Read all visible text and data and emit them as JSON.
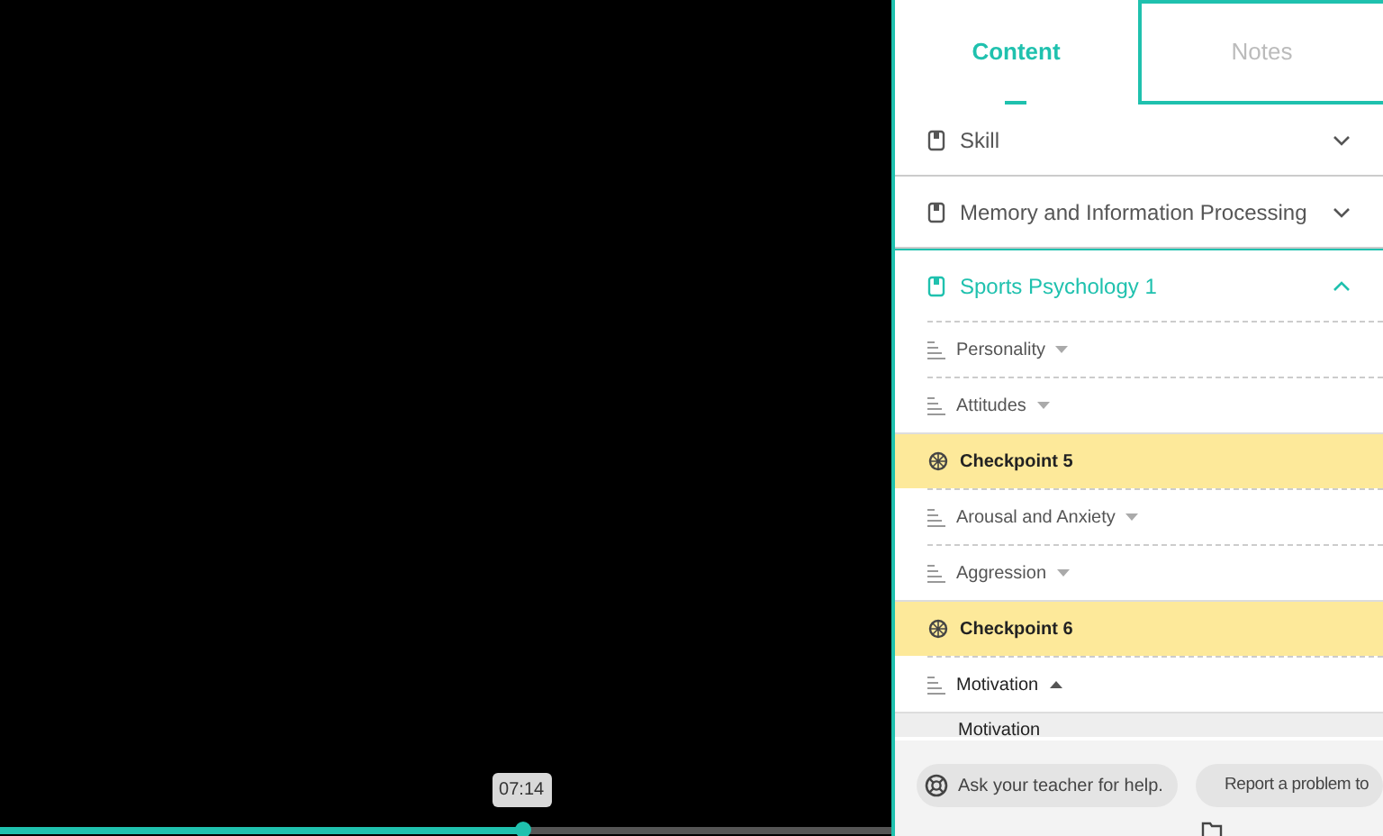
{
  "video": {
    "progress": {
      "level": 0.585
    },
    "time_tooltip": "07:14"
  },
  "tabs": [
    {
      "label": "Content",
      "selected": true
    },
    {
      "label": "Notes",
      "selected": false
    }
  ],
  "sections": [
    {
      "title": "Skill",
      "expanded": false
    },
    {
      "title": "Memory and Information Processing",
      "expanded": false
    },
    {
      "title": "Sports Psychology 1",
      "expanded": true,
      "items": [
        {
          "kind": "lesson",
          "label": "Personality",
          "expanded": false
        },
        {
          "kind": "lesson",
          "label": "Attitudes",
          "expanded": false
        },
        {
          "kind": "checkpoint",
          "label": "Checkpoint 5"
        },
        {
          "kind": "lesson",
          "label": "Arousal and Anxiety",
          "expanded": false
        },
        {
          "kind": "lesson",
          "label": "Aggression",
          "expanded": false
        },
        {
          "kind": "checkpoint",
          "label": "Checkpoint 6"
        },
        {
          "kind": "lesson",
          "label": "Motivation",
          "expanded": true,
          "children": [
            {
              "label": "Motivation"
            }
          ]
        }
      ]
    }
  ],
  "footer": {
    "help_button": "Ask your teacher for help.",
    "report_button": "Report a problem to"
  }
}
